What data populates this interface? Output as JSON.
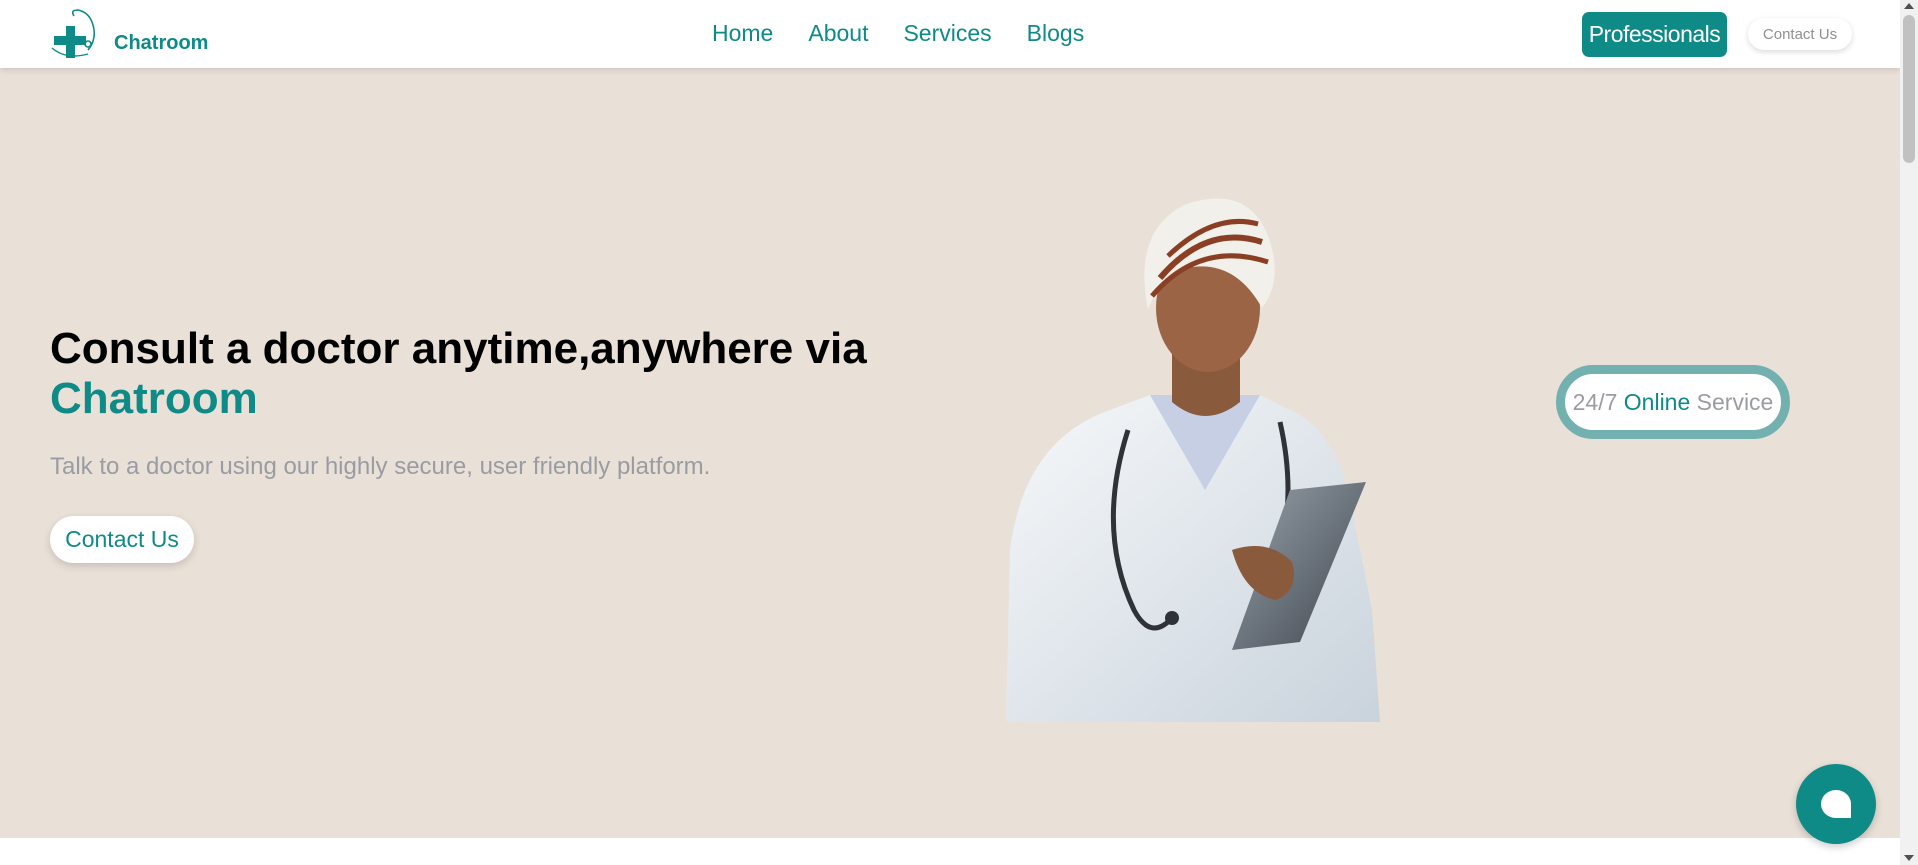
{
  "header": {
    "logo_text": "Chatroom",
    "nav": [
      {
        "label": "Home"
      },
      {
        "label": "About"
      },
      {
        "label": "Services"
      },
      {
        "label": "Blogs"
      }
    ],
    "professionals_label": "Professionals",
    "contact_label": "Contact Us"
  },
  "hero": {
    "title_line1": "Consult a doctor anytime,anywhere via",
    "title_brand": "Chatroom",
    "subtitle": "Talk to a doctor using our highly secure, user friendly platform.",
    "cta_label": "Contact Us"
  },
  "badge": {
    "part1": "24/7",
    "part2": "Online",
    "part3": "Service"
  },
  "icons": {
    "logo": "medical-cross-stethoscope-icon",
    "chat": "chat-bubble-icon",
    "doctor": "doctor-illustration"
  },
  "colors": {
    "brand": "#0e8a87",
    "hero_bg": "#e9e0d7",
    "badge_ring": "#72b1b0",
    "muted_text": "#9a9ca3"
  }
}
